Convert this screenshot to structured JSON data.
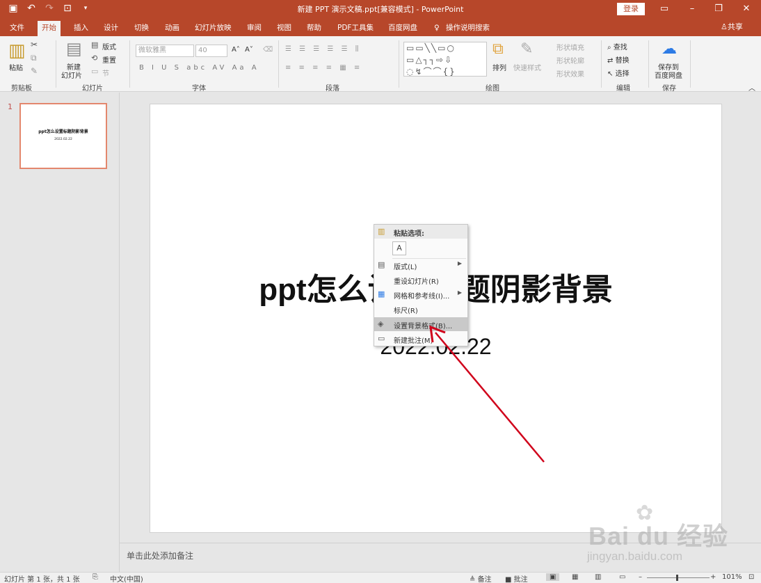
{
  "window": {
    "title": "新建 PPT 演示文稿.ppt[兼容模式] - PowerPoint",
    "login": "登录",
    "share": "共享"
  },
  "tabs": [
    {
      "label": "文件"
    },
    {
      "label": "开始"
    },
    {
      "label": "插入"
    },
    {
      "label": "设计"
    },
    {
      "label": "切换"
    },
    {
      "label": "动画"
    },
    {
      "label": "幻灯片放映"
    },
    {
      "label": "审阅"
    },
    {
      "label": "视图"
    },
    {
      "label": "帮助"
    },
    {
      "label": "PDF工具集"
    },
    {
      "label": "百度网盘"
    },
    {
      "label": "操作说明搜索"
    }
  ],
  "ribbon": {
    "clipboard": {
      "paste": "粘贴",
      "label": "剪贴板"
    },
    "slides": {
      "new_slide": "新建",
      "new_slide2": "幻灯片",
      "layout": "版式",
      "reset": "重置",
      "section": "节",
      "label": "幻灯片"
    },
    "font": {
      "font_name": "微软雅黑",
      "font_size": "40",
      "label": "字体"
    },
    "paragraph": {
      "label": "段落"
    },
    "drawing": {
      "arrange": "排列",
      "quick_styles": "快速样式",
      "fill": "形状填充",
      "outline": "形状轮廓",
      "effects": "形状效果",
      "label": "绘图"
    },
    "editing": {
      "find": "查找",
      "replace": "替换",
      "select": "选择",
      "label": "编辑"
    },
    "save": {
      "save_to": "保存到",
      "baidu": "百度网盘",
      "label": "保存"
    }
  },
  "slide_panel": {
    "number": "1",
    "thumb_title": "ppt怎么设置标题阴影背景",
    "thumb_date": "2022.02.22"
  },
  "slide": {
    "title": "ppt怎么设置标题阴影背景",
    "subtitle": "2022.02.22"
  },
  "context_menu": {
    "paste_header": "粘贴选项:",
    "paste_option": "A",
    "items": [
      {
        "label": "版式(L)"
      },
      {
        "label": "重设幻灯片(R)"
      },
      {
        "label": "网格和参考线(I)..."
      },
      {
        "label": "标尺(R)"
      },
      {
        "label": "设置背景格式(B)..."
      },
      {
        "label": "新建批注(M)"
      }
    ]
  },
  "notes": {
    "placeholder": "单击此处添加备注"
  },
  "status": {
    "slide_info": "幻灯片 第 1 张，共 1 张",
    "language": "中文(中国)",
    "notes": "备注",
    "comments": "批注",
    "zoom": "101%"
  },
  "watermark": {
    "main": "Bai du 经验",
    "sub": "jingyan.baidu.com"
  },
  "colors": {
    "accent": "#b7472a",
    "thumb_border": "#e3876d",
    "arrow": "#d0021b"
  }
}
